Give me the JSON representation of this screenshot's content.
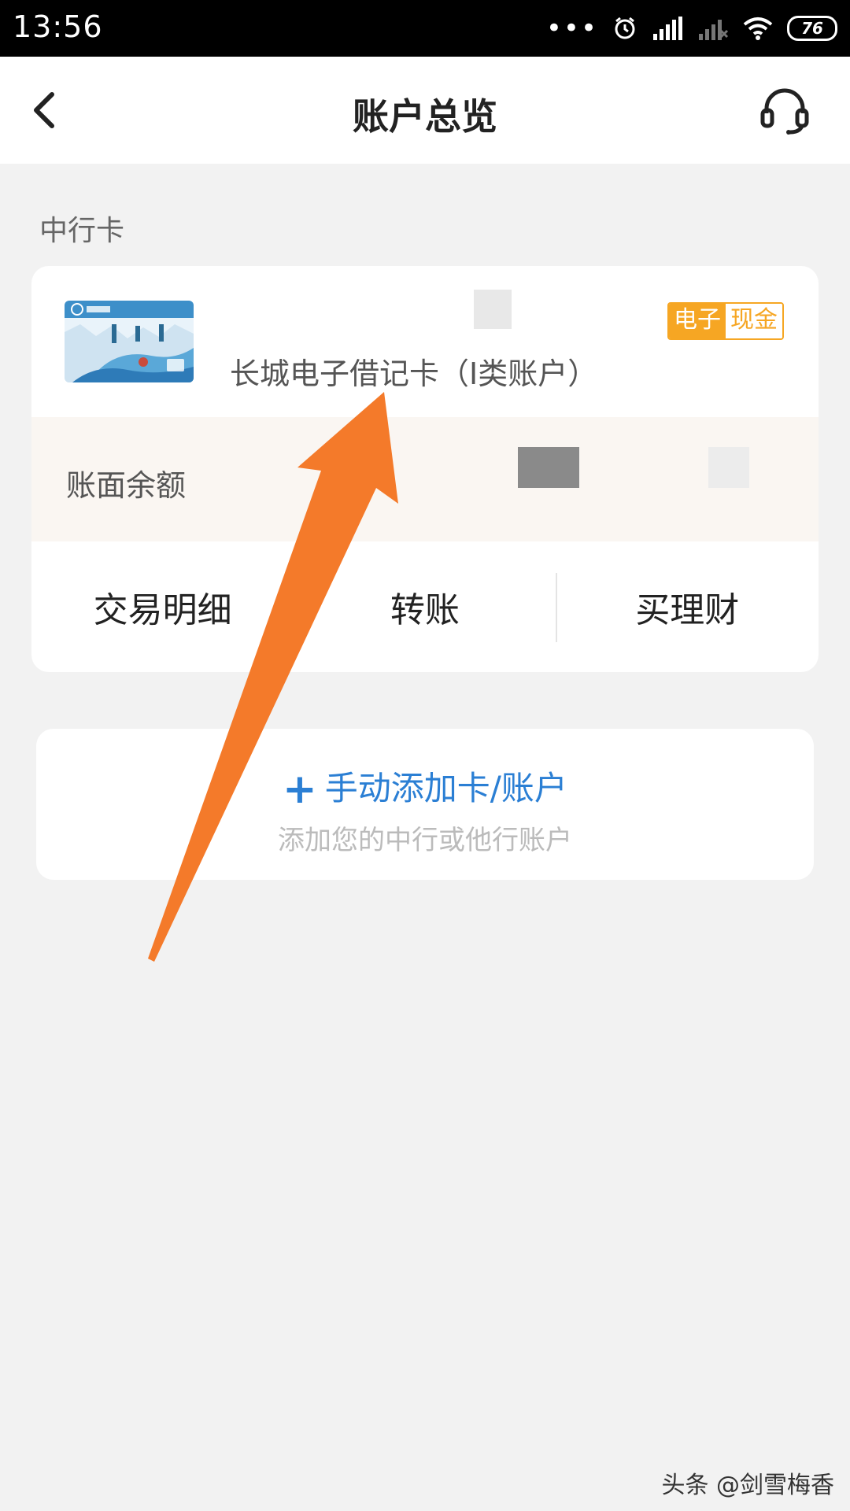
{
  "status_bar": {
    "time": "13:56",
    "battery": "76"
  },
  "navbar": {
    "title": "账户总览"
  },
  "section": {
    "label": "中行卡"
  },
  "account_card": {
    "card_name": "长城电子借记卡（I类账户）",
    "tag_part1": "电子",
    "tag_part2": "现金",
    "balance_label": "账面余额",
    "actions": [
      "交易明细",
      "转账",
      "买理财"
    ]
  },
  "add_account": {
    "title": "手动添加卡/账户",
    "subtitle": "添加您的中行或他行账户"
  },
  "watermark": "头条 @剑雪梅香",
  "colors": {
    "accent_blue": "#2b7fd4",
    "tag_orange": "#f6a623",
    "arrow_orange": "#f47a2a"
  }
}
